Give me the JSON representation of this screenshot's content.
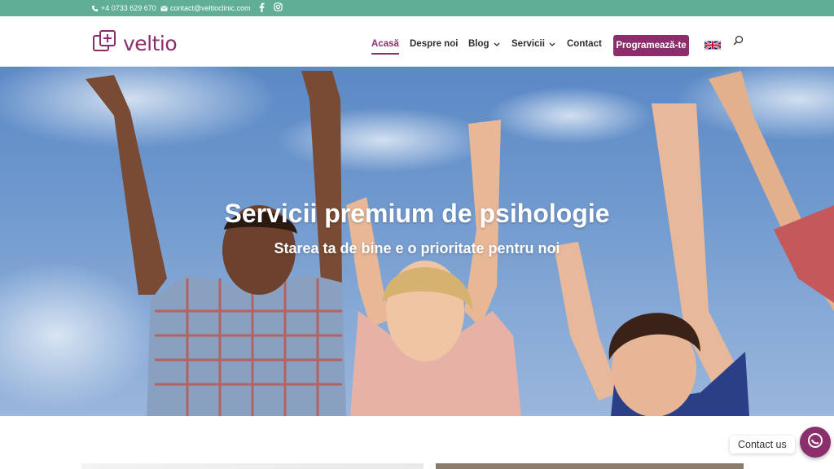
{
  "topbar": {
    "phone": "+4 0733 629 670",
    "email": "contact@veltioclinic.com",
    "social": [
      "facebook-icon",
      "instagram-icon"
    ],
    "background": "#5fae95"
  },
  "header": {
    "logo_text": "veltio",
    "nav": [
      {
        "label": "Acasă",
        "active": true
      },
      {
        "label": "Despre noi",
        "active": false
      },
      {
        "label": "Blog",
        "has_dropdown": true
      },
      {
        "label": "Servicii",
        "has_dropdown": true
      },
      {
        "label": "Contact",
        "active": false
      }
    ],
    "cta_label": "Programează-te",
    "language": "english-flag-icon",
    "search": "search-icon",
    "accent_color": "#8a2f6b"
  },
  "hero": {
    "title": "Servicii premium de psihologie",
    "subtitle": "Starea ta de bine e o prioritate pentru noi"
  },
  "contact_widget": {
    "label": "Contact us"
  }
}
